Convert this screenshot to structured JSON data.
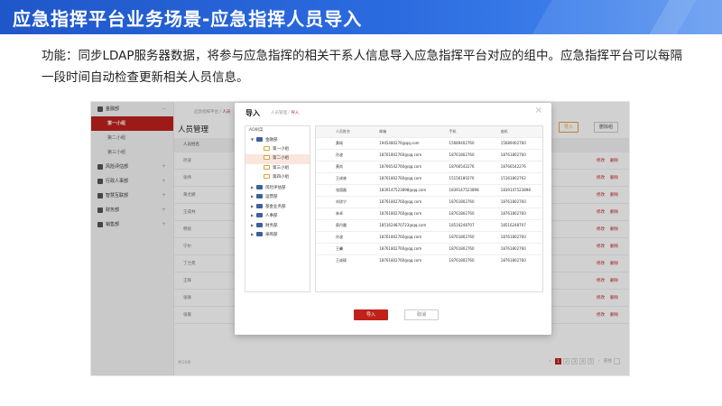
{
  "slide": {
    "title": "应急指挥平台业务场景-应急指挥人员导入",
    "description": "功能：同步LDAP服务器数据，将参与应急指挥的相关干系人信息导入应急指挥平台对应的组中。应急指挥平台可以每隔一段时间自动检查更新相关人员信息。"
  },
  "colors": {
    "brand_red": "#c0221b",
    "header_blue": "#1f57c9"
  },
  "sidebar": {
    "groups": [
      {
        "label": "金融部",
        "icon": "org-icon",
        "subitems": [
          "第一小组",
          "第二小组",
          "第三小组"
        ],
        "active_sub": 0
      },
      {
        "label": "风险评估部",
        "icon": "org-icon"
      },
      {
        "label": "行政人事部",
        "icon": "org-icon"
      },
      {
        "label": "智慧互联部",
        "icon": "org-icon"
      },
      {
        "label": "财务部",
        "icon": "org-icon"
      },
      {
        "label": "销售部",
        "icon": "org-icon"
      }
    ]
  },
  "background_page": {
    "breadcrumb_prefix": "应急指挥平台 /",
    "breadcrumb_current": "人员",
    "title": "人员管理",
    "import_button": "导入",
    "delete_button": "删除组",
    "table_header": "人员姓名",
    "rows": [
      "孙波",
      "张伟",
      "黄尤娜",
      "王成林",
      "韩祯",
      "宁尔",
      "丁兰苑",
      "王辉",
      "张锋",
      "张嘉"
    ],
    "row_actions": [
      "修改",
      "删除"
    ],
    "total_text": "共10条",
    "pages": [
      "1",
      "2",
      "3",
      "4",
      "5"
    ],
    "pager_prev": "‹",
    "pager_next": "›",
    "goto": "前往"
  },
  "dialog": {
    "title": "导入",
    "breadcrumb_prefix": "人员管理 /",
    "breadcrumb_current": "导入",
    "close_label": "×",
    "tree_header": "AD树菜",
    "tree": [
      {
        "label": "金融部",
        "level": 0,
        "expanded": true
      },
      {
        "label": "第一小组",
        "level": 1
      },
      {
        "label": "第二小组",
        "level": 1,
        "selected": true
      },
      {
        "label": "第三小组",
        "level": 1
      },
      {
        "label": "第四小组",
        "level": 1
      },
      {
        "label": "风险评估部",
        "level": 0
      },
      {
        "label": "运营部",
        "level": 0
      },
      {
        "label": "基金业务部",
        "level": 0
      },
      {
        "label": "人事部",
        "level": 0
      },
      {
        "label": "财务部",
        "level": 0
      },
      {
        "label": "采购部",
        "level": 0
      }
    ],
    "columns": [
      "人员姓名",
      "邮箱",
      "手机",
      "座机"
    ],
    "rows": [
      [
        "黄瑶",
        "1945480276@qq.com",
        "15689402760",
        "15689402760"
      ],
      [
        "孙波",
        "18761802760@qq.com",
        "18761802760",
        "18761802760"
      ],
      [
        "黄尚",
        "18766542760@qq.com",
        "18766542276",
        "18766542276"
      ],
      [
        "王成林",
        "18761802760@qq.com",
        "15156180276",
        "15161802762"
      ],
      [
        "张国磊",
        "1839147523898@qq.com",
        "1839147523898",
        "1839147523898"
      ],
      [
        "刘欣宁",
        "18761802760@qq.com",
        "18761802760",
        "18761802760"
      ],
      [
        "朱卓",
        "18761802760@qq.com",
        "18761802760",
        "18761802760"
      ],
      [
        "蔡丹晨",
        "1851624870723@qq.com",
        "18516248707",
        "18516248707"
      ],
      [
        "孙波",
        "18761802760@qq.com",
        "18761802760",
        "18761802760"
      ],
      [
        "王馨",
        "18761802760@qq.com",
        "18761802760",
        "18761802760"
      ],
      [
        "王成硕",
        "18761802760@qq.com",
        "18761802760",
        "18761802760"
      ]
    ],
    "ok_button": "导入",
    "cancel_button": "取消"
  }
}
